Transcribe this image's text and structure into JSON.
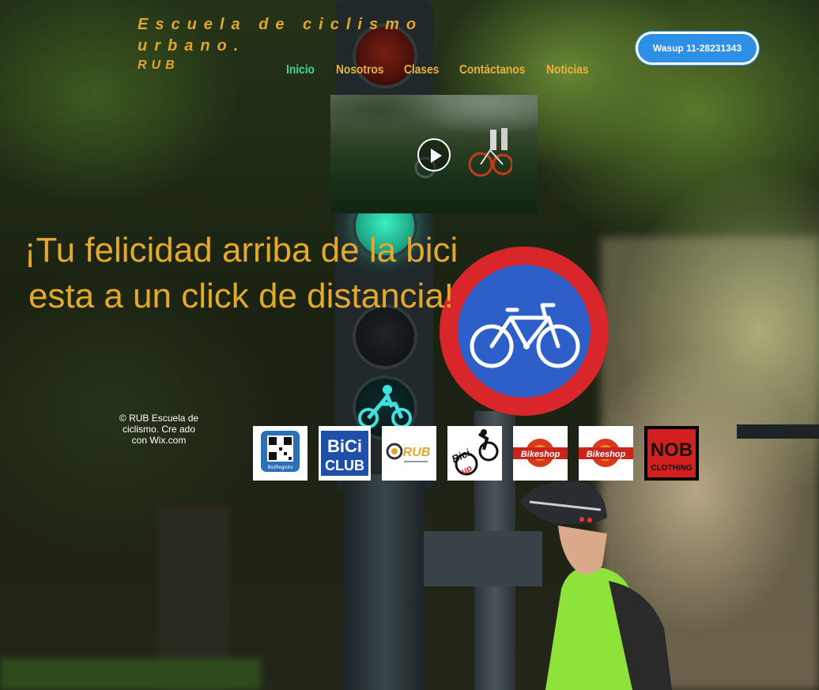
{
  "header": {
    "site_title": "Escuela de ciclismo urbano.",
    "site_subtitle": "RUB"
  },
  "nav": {
    "items": [
      {
        "label": "Inicio",
        "active": true
      },
      {
        "label": "Nosotros",
        "active": false
      },
      {
        "label": "Clases",
        "active": false
      },
      {
        "label": "Contáctanos",
        "active": false
      },
      {
        "label": "Noticias",
        "active": false
      }
    ]
  },
  "whatsapp_button": {
    "label": "Wasup 11-28231343",
    "color": "#2d8fe6"
  },
  "video": {
    "icon": "play-icon"
  },
  "hero": {
    "headline": "¡Tu felicidad arriba de la bici esta a un click de distancia!"
  },
  "footer": {
    "credit": "© RUB Escuela de ciclismo. Cre ado con Wix.com"
  },
  "sponsor_logos": [
    {
      "name": "bicircuit-registro-logo",
      "text": "BiciRegistro"
    },
    {
      "name": "bici-club-logo",
      "text": "BiCi CLUB"
    },
    {
      "name": "rub-logo",
      "text": "RUB"
    },
    {
      "name": "bici-up-logo",
      "text": "Bici up"
    },
    {
      "name": "bikeshop-logo",
      "text": "Bikeshop"
    },
    {
      "name": "bikeshop-logo-2",
      "text": "Bikeshop"
    },
    {
      "name": "nob-clothing-logo",
      "text": "NOB CLOTHING"
    }
  ],
  "colors": {
    "accent": "#e3a52a",
    "nav_active": "#40d8a4",
    "button": "#2d8fe6"
  }
}
